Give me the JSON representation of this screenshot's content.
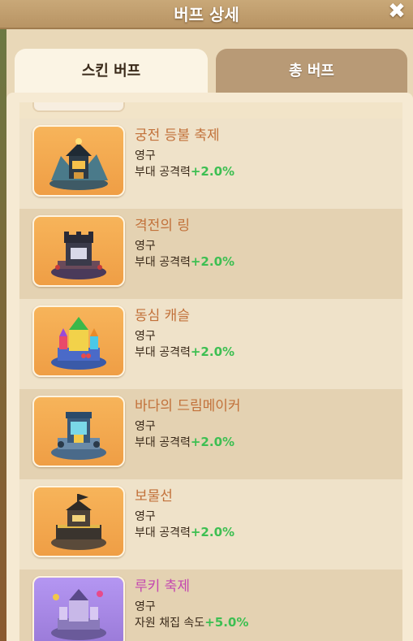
{
  "window": {
    "title": "버프 상세"
  },
  "tabs": [
    {
      "label": "스킨 버프",
      "active": true
    },
    {
      "label": "총 버프",
      "active": false
    }
  ],
  "buffs": [
    {
      "name": "궁전 등불 축제",
      "duration": "영구",
      "effect": "부대 공격력",
      "bonus": "+2.0%",
      "icon": "palace-lantern-building-icon",
      "card_color": "#f4a94f"
    },
    {
      "name": "격전의 링",
      "duration": "영구",
      "effect": "부대 공격력",
      "bonus": "+2.0%",
      "icon": "battle-ring-tower-icon",
      "card_color": "#f4a94f"
    },
    {
      "name": "동심 캐슬",
      "duration": "영구",
      "effect": "부대 공격력",
      "bonus": "+2.0%",
      "icon": "toy-castle-icon",
      "card_color": "#f4a94f"
    },
    {
      "name": "바다의 드림메이커",
      "duration": "영구",
      "effect": "부대 공격력",
      "bonus": "+2.0%",
      "icon": "sea-dreammaker-tower-icon",
      "card_color": "#f4a94f"
    },
    {
      "name": "보물선",
      "duration": "영구",
      "effect": "부대 공격력",
      "bonus": "+2.0%",
      "icon": "treasure-ship-icon",
      "card_color": "#f4a94f"
    },
    {
      "name": "루키 축제",
      "duration": "영구",
      "effect": "자원 채집 속도",
      "bonus": "+5.0%",
      "icon": "rookie-festival-castle-icon",
      "card_color": "#a98ae6"
    }
  ],
  "colors": {
    "name_orange": "#c2713a",
    "name_pink": "#c448b0",
    "bonus_green": "#3dbf52"
  }
}
